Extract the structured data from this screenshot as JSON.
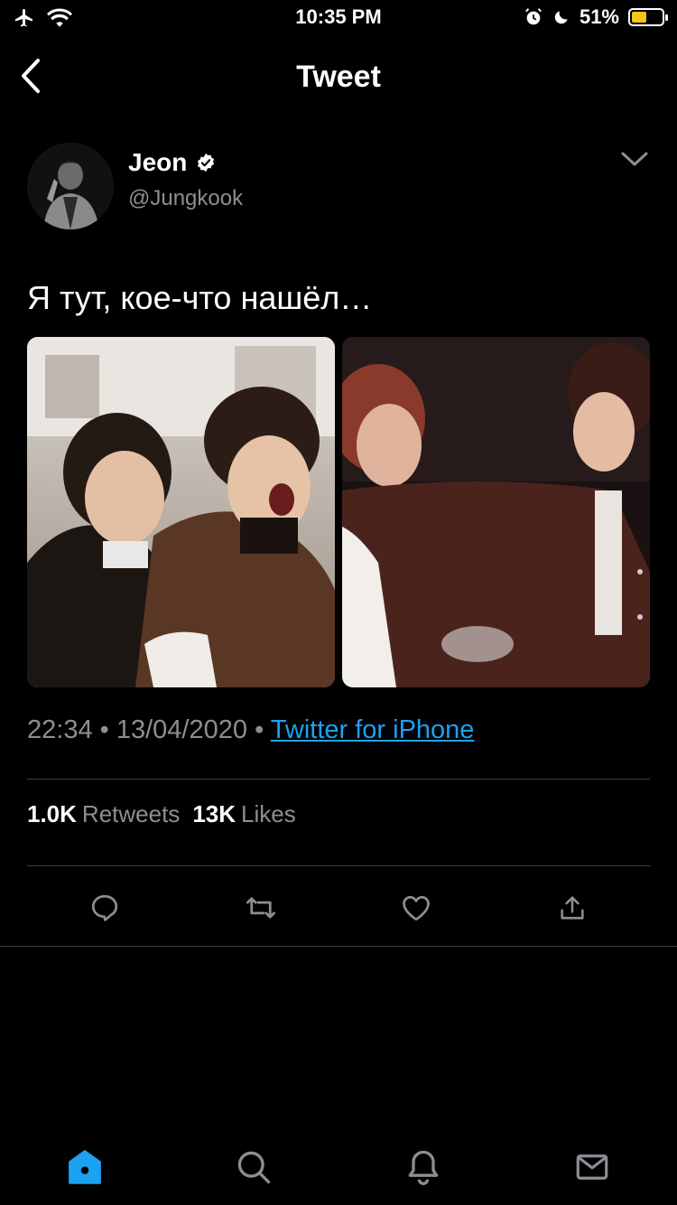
{
  "status_bar": {
    "time": "10:35 PM",
    "battery_percent": "51%",
    "battery_level": 0.51,
    "icons": [
      "airplane-icon",
      "wifi-icon",
      "alarm-icon",
      "moon-icon",
      "battery-icon"
    ]
  },
  "nav": {
    "title": "Tweet",
    "back_icon": "chevron-left-icon"
  },
  "tweet": {
    "author": {
      "display_name": "Jeon",
      "handle": "@Jungkook",
      "verified": true
    },
    "text": "Я тут, кое-что нашёл…",
    "time": "22:34",
    "date": "13/04/2020",
    "separator": "•",
    "source": "Twitter for iPhone",
    "stats": {
      "retweets_count": "1.0K",
      "retweets_label": "Retweets",
      "likes_count": "13K",
      "likes_label": "Likes"
    }
  },
  "actions": [
    "reply-icon",
    "retweet-icon",
    "like-icon",
    "share-icon"
  ],
  "tab_bar": [
    "home-icon",
    "search-icon",
    "notifications-icon",
    "messages-icon"
  ],
  "colors": {
    "accent": "#1da1f2",
    "background": "#000000",
    "muted": "#8b8f94",
    "divider": "#38444d",
    "battery_fill": "#f5c518"
  }
}
